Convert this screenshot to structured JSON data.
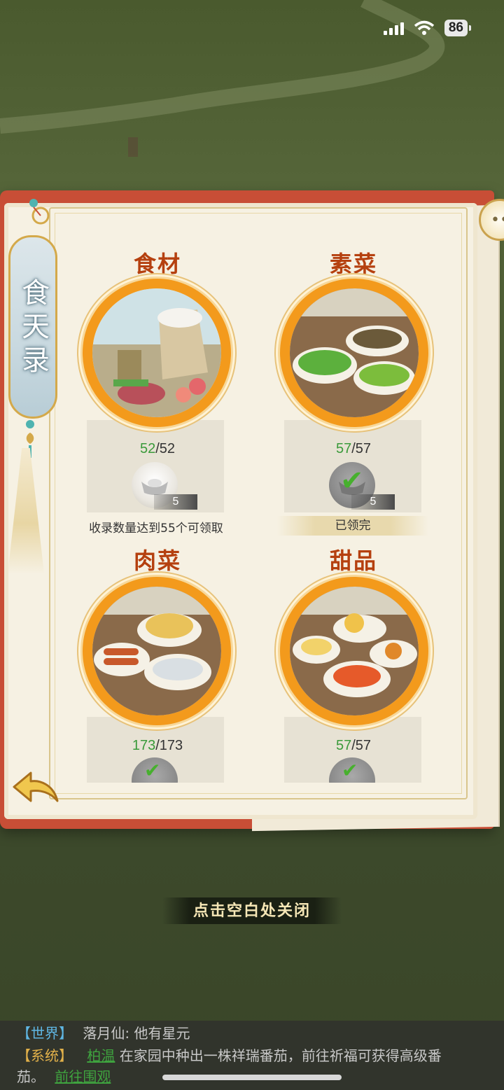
{
  "status_bar": {
    "battery": "86"
  },
  "book": {
    "title": "食天录",
    "categories": [
      {
        "id": "ingredients",
        "title": "食材",
        "current": "52",
        "total": "/52",
        "reward_count": "5",
        "status_text": "收录数量达到55个可领取",
        "claimed": false
      },
      {
        "id": "vegetarian",
        "title": "素菜",
        "current": "57",
        "total": "/57",
        "reward_count": "5",
        "status_text": "已领完",
        "claimed": true
      },
      {
        "id": "meat",
        "title": "肉菜",
        "current": "173",
        "total": "/173",
        "claimed": true
      },
      {
        "id": "dessert",
        "title": "甜品",
        "current": "57",
        "total": "/57",
        "claimed": true
      }
    ]
  },
  "close_hint": "点击空白处关闭",
  "chat": {
    "line1": {
      "tag": "【世界】",
      "text": "落月仙: 他有星元"
    },
    "line2": {
      "tag": "【系统】",
      "user": "柏温",
      "text": "在家园中种出一株祥瑞番茄，前往祈福可获得高级番"
    },
    "line3": {
      "text": "茄。",
      "link": "前往围观"
    }
  },
  "colors": {
    "accent_orange": "#f39a1c",
    "title_red": "#b5400f",
    "progress_green": "#3a9a3a",
    "book_cover": "#c84e36"
  },
  "icons": [
    "signal-icon",
    "wifi-icon",
    "chat-bubble-icon",
    "silver-ingot-icon",
    "checkmark-icon",
    "back-arrow-icon"
  ]
}
